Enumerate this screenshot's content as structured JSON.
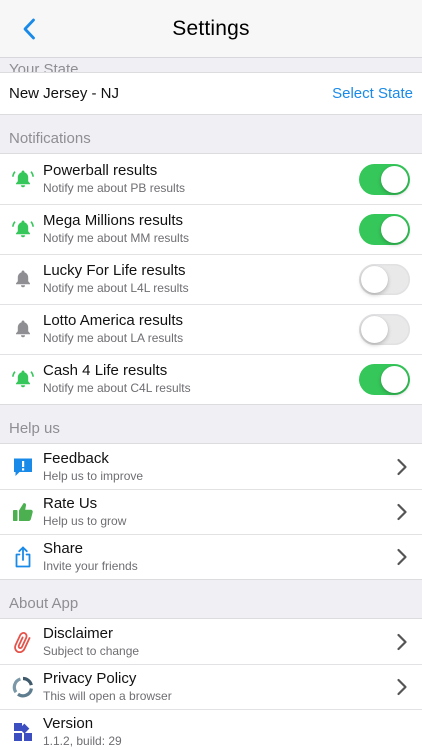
{
  "navbar": {
    "title": "Settings",
    "back_icon": "chevron-left-icon"
  },
  "colors": {
    "accent": "#1a8ae8",
    "toggle_on": "#35c759",
    "bell_on": "#35c759",
    "bell_off": "#8e8e93"
  },
  "state_section": {
    "header": "Your State",
    "state_name": "New Jersey - NJ",
    "select_label": "Select State"
  },
  "notifications": {
    "header": "Notifications",
    "items": [
      {
        "title": "Powerball results",
        "subtitle": "Notify me about PB results",
        "enabled": true,
        "icon": "bell-ringing-icon"
      },
      {
        "title": "Mega Millions results",
        "subtitle": "Notify me about MM results",
        "enabled": true,
        "icon": "bell-ringing-icon"
      },
      {
        "title": "Lucky For Life results",
        "subtitle": "Notify me about L4L results",
        "enabled": false,
        "icon": "bell-icon"
      },
      {
        "title": "Lotto America results",
        "subtitle": "Notify me about LA results",
        "enabled": false,
        "icon": "bell-icon"
      },
      {
        "title": "Cash 4 Life results",
        "subtitle": "Notify me about C4L results",
        "enabled": true,
        "icon": "bell-ringing-icon"
      }
    ]
  },
  "help_us": {
    "header": "Help us",
    "items": [
      {
        "title": "Feedback",
        "subtitle": "Help us to improve",
        "icon": "feedback-icon"
      },
      {
        "title": "Rate Us",
        "subtitle": "Help us to grow",
        "icon": "thumbs-up-icon"
      },
      {
        "title": "Share",
        "subtitle": "Invite your friends",
        "icon": "share-icon"
      }
    ]
  },
  "about_app": {
    "header": "About App",
    "items": [
      {
        "title": "Disclaimer",
        "subtitle": "Subject to change",
        "icon": "paperclip-icon",
        "chevron": true
      },
      {
        "title": "Privacy Policy",
        "subtitle": "This will open a browser",
        "icon": "privacy-ring-icon",
        "chevron": true
      },
      {
        "title": "Version",
        "subtitle": "1.1.2, build: 29",
        "icon": "grid-blocks-icon",
        "chevron": false
      }
    ]
  }
}
